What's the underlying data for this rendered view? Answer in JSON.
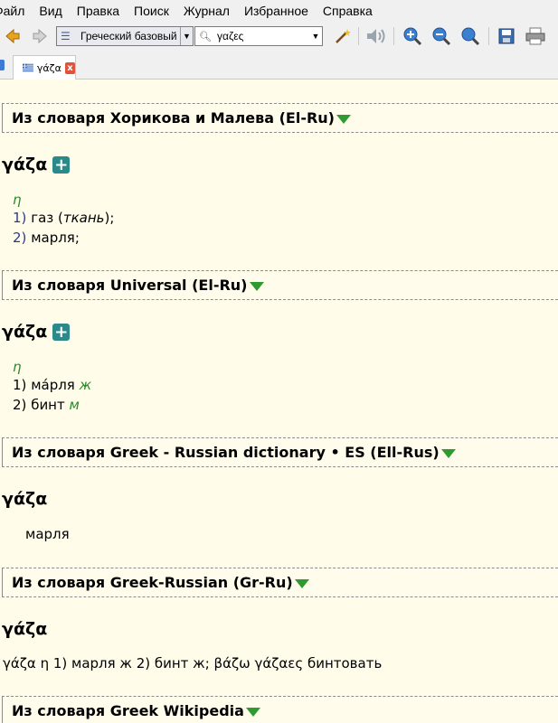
{
  "menu": [
    "Файл",
    "Вид",
    "Правка",
    "Поиск",
    "Журнал",
    "Избранное",
    "Справка"
  ],
  "toolbar": {
    "group_value": "Греческий базовый",
    "search_value": "γαζες"
  },
  "tab": {
    "label": "γάζα",
    "close": "x"
  },
  "entries": [
    {
      "header_prefix": "Из словаря",
      "dict_name": "Хорикова и Малева (El-Ru)",
      "headword": "γάζα",
      "gender": "η",
      "senses": [
        {
          "num": "1)",
          "text": "газ (",
          "italic": "ткань",
          "tail": ");"
        },
        {
          "num": "2)",
          "text": "марля;"
        }
      ]
    },
    {
      "header_prefix": "Из словаря",
      "dict_name": "Universal (El-Ru)",
      "headword": "γάζα",
      "gender": "η",
      "senses": [
        {
          "num": "1)",
          "text": "ма́рля",
          "gram": "ж"
        },
        {
          "num": "2)",
          "text": "бинт",
          "gram": "м"
        }
      ]
    },
    {
      "header_prefix": "Из словаря",
      "dict_name": "Greek - Russian dictionary • ES (Ell-Rus)",
      "headword": "γάζα",
      "text": "марля"
    },
    {
      "header_prefix": "Из словаря",
      "dict_name": "Greek-Russian (Gr-Ru)",
      "headword": "γάζα",
      "text": "γάζα η 1) марля ж 2) бинт ж; βάζω γάζαες бинтовать"
    },
    {
      "header_prefix": "Из словаря",
      "dict_name": "Greek Wikipedia"
    }
  ]
}
